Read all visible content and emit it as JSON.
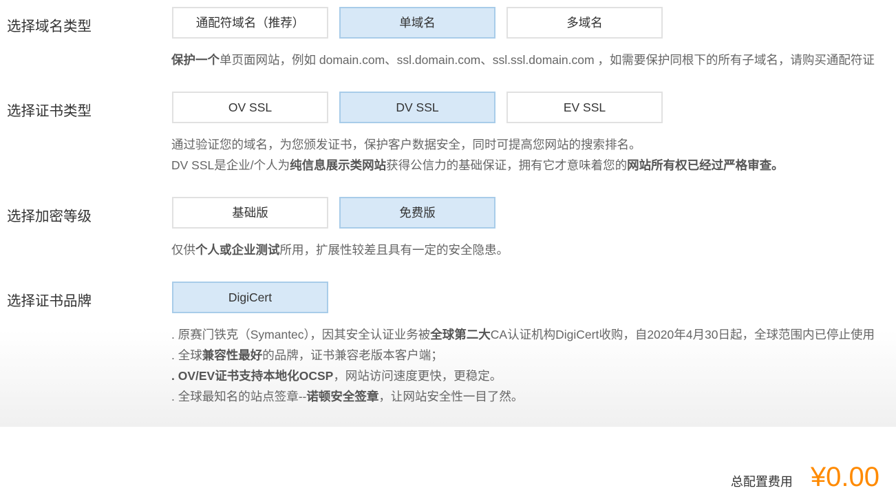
{
  "sections": [
    {
      "label": "选择域名类型",
      "options": [
        {
          "label": "通配符域名（推荐）",
          "selected": false
        },
        {
          "label": "单域名",
          "selected": true
        },
        {
          "label": "多域名",
          "selected": false
        }
      ],
      "description": [
        [
          "保护一个",
          "单页面网站，例如 domain.com、ssl.domain.com、ssl.ssl.domain.com ，如需要保护同根下的所有子域名，请购买通配符证"
        ]
      ]
    },
    {
      "label": "选择证书类型",
      "options": [
        {
          "label": "OV SSL",
          "selected": false
        },
        {
          "label": "DV SSL",
          "selected": true
        },
        {
          "label": "EV SSL",
          "selected": false
        }
      ],
      "description": [
        [
          "通过验证您的域名，为您颁发证书，保护客户数据安全，同时可提高您网站的搜索排名。"
        ],
        [
          "DV SSL是企业/个人为",
          "纯信息展示类网站",
          "获得公信力的基础保证，拥有它才意味着您的",
          "网站所有权已经过严格审查。"
        ]
      ]
    },
    {
      "label": "选择加密等级",
      "options": [
        {
          "label": "基础版",
          "selected": false
        },
        {
          "label": "免费版",
          "selected": true
        }
      ],
      "description": [
        [
          "仅供",
          "个人或企业测试",
          "所用，扩展性较差且具有一定的安全隐患。"
        ]
      ]
    },
    {
      "label": "选择证书品牌",
      "options": [
        {
          "label": "DigiCert",
          "selected": true
        }
      ],
      "description": [
        [
          ". 原赛门铁克（Symantec），因其安全认证业务被",
          "全球第二大",
          "CA认证机构DigiCert收购，自2020年4月30日起，全球范围内已停止使用"
        ],
        [
          ". 全球",
          "兼容性最好",
          "的品牌，证书兼容老版本客户端；"
        ],
        [
          ". OV/EV证书支持本地化OCSP",
          "，网站访问速度更快，更稳定。"
        ],
        [
          ". 全球最知名的站点签章--",
          "诺顿安全签章",
          "，让网站安全性一目了然。"
        ]
      ]
    }
  ],
  "total": {
    "label": "总配置费用",
    "price": "¥0.00"
  },
  "colors": {
    "price": "#ff8a00",
    "selected_bg": "#d7e8f7",
    "selected_border": "#a8cce9",
    "option_border": "#e1e1e1"
  }
}
